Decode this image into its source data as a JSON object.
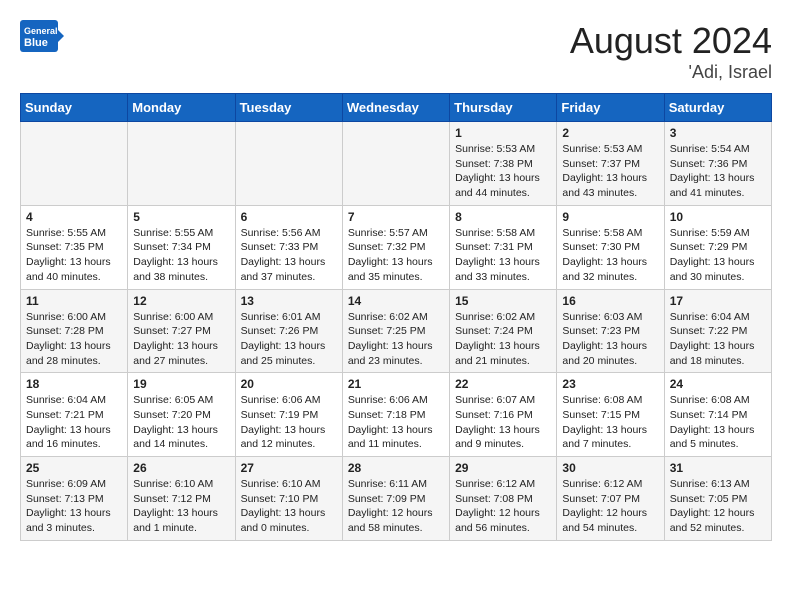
{
  "header": {
    "logo_general": "General",
    "logo_blue": "Blue",
    "month_year": "August 2024",
    "location": "'Adi, Israel"
  },
  "weekdays": [
    "Sunday",
    "Monday",
    "Tuesday",
    "Wednesday",
    "Thursday",
    "Friday",
    "Saturday"
  ],
  "weeks": [
    [
      {
        "day": "",
        "info": ""
      },
      {
        "day": "",
        "info": ""
      },
      {
        "day": "",
        "info": ""
      },
      {
        "day": "",
        "info": ""
      },
      {
        "day": "1",
        "info": "Sunrise: 5:53 AM\nSunset: 7:38 PM\nDaylight: 13 hours\nand 44 minutes."
      },
      {
        "day": "2",
        "info": "Sunrise: 5:53 AM\nSunset: 7:37 PM\nDaylight: 13 hours\nand 43 minutes."
      },
      {
        "day": "3",
        "info": "Sunrise: 5:54 AM\nSunset: 7:36 PM\nDaylight: 13 hours\nand 41 minutes."
      }
    ],
    [
      {
        "day": "4",
        "info": "Sunrise: 5:55 AM\nSunset: 7:35 PM\nDaylight: 13 hours\nand 40 minutes."
      },
      {
        "day": "5",
        "info": "Sunrise: 5:55 AM\nSunset: 7:34 PM\nDaylight: 13 hours\nand 38 minutes."
      },
      {
        "day": "6",
        "info": "Sunrise: 5:56 AM\nSunset: 7:33 PM\nDaylight: 13 hours\nand 37 minutes."
      },
      {
        "day": "7",
        "info": "Sunrise: 5:57 AM\nSunset: 7:32 PM\nDaylight: 13 hours\nand 35 minutes."
      },
      {
        "day": "8",
        "info": "Sunrise: 5:58 AM\nSunset: 7:31 PM\nDaylight: 13 hours\nand 33 minutes."
      },
      {
        "day": "9",
        "info": "Sunrise: 5:58 AM\nSunset: 7:30 PM\nDaylight: 13 hours\nand 32 minutes."
      },
      {
        "day": "10",
        "info": "Sunrise: 5:59 AM\nSunset: 7:29 PM\nDaylight: 13 hours\nand 30 minutes."
      }
    ],
    [
      {
        "day": "11",
        "info": "Sunrise: 6:00 AM\nSunset: 7:28 PM\nDaylight: 13 hours\nand 28 minutes."
      },
      {
        "day": "12",
        "info": "Sunrise: 6:00 AM\nSunset: 7:27 PM\nDaylight: 13 hours\nand 27 minutes."
      },
      {
        "day": "13",
        "info": "Sunrise: 6:01 AM\nSunset: 7:26 PM\nDaylight: 13 hours\nand 25 minutes."
      },
      {
        "day": "14",
        "info": "Sunrise: 6:02 AM\nSunset: 7:25 PM\nDaylight: 13 hours\nand 23 minutes."
      },
      {
        "day": "15",
        "info": "Sunrise: 6:02 AM\nSunset: 7:24 PM\nDaylight: 13 hours\nand 21 minutes."
      },
      {
        "day": "16",
        "info": "Sunrise: 6:03 AM\nSunset: 7:23 PM\nDaylight: 13 hours\nand 20 minutes."
      },
      {
        "day": "17",
        "info": "Sunrise: 6:04 AM\nSunset: 7:22 PM\nDaylight: 13 hours\nand 18 minutes."
      }
    ],
    [
      {
        "day": "18",
        "info": "Sunrise: 6:04 AM\nSunset: 7:21 PM\nDaylight: 13 hours\nand 16 minutes."
      },
      {
        "day": "19",
        "info": "Sunrise: 6:05 AM\nSunset: 7:20 PM\nDaylight: 13 hours\nand 14 minutes."
      },
      {
        "day": "20",
        "info": "Sunrise: 6:06 AM\nSunset: 7:19 PM\nDaylight: 13 hours\nand 12 minutes."
      },
      {
        "day": "21",
        "info": "Sunrise: 6:06 AM\nSunset: 7:18 PM\nDaylight: 13 hours\nand 11 minutes."
      },
      {
        "day": "22",
        "info": "Sunrise: 6:07 AM\nSunset: 7:16 PM\nDaylight: 13 hours\nand 9 minutes."
      },
      {
        "day": "23",
        "info": "Sunrise: 6:08 AM\nSunset: 7:15 PM\nDaylight: 13 hours\nand 7 minutes."
      },
      {
        "day": "24",
        "info": "Sunrise: 6:08 AM\nSunset: 7:14 PM\nDaylight: 13 hours\nand 5 minutes."
      }
    ],
    [
      {
        "day": "25",
        "info": "Sunrise: 6:09 AM\nSunset: 7:13 PM\nDaylight: 13 hours\nand 3 minutes."
      },
      {
        "day": "26",
        "info": "Sunrise: 6:10 AM\nSunset: 7:12 PM\nDaylight: 13 hours\nand 1 minute."
      },
      {
        "day": "27",
        "info": "Sunrise: 6:10 AM\nSunset: 7:10 PM\nDaylight: 13 hours\nand 0 minutes."
      },
      {
        "day": "28",
        "info": "Sunrise: 6:11 AM\nSunset: 7:09 PM\nDaylight: 12 hours\nand 58 minutes."
      },
      {
        "day": "29",
        "info": "Sunrise: 6:12 AM\nSunset: 7:08 PM\nDaylight: 12 hours\nand 56 minutes."
      },
      {
        "day": "30",
        "info": "Sunrise: 6:12 AM\nSunset: 7:07 PM\nDaylight: 12 hours\nand 54 minutes."
      },
      {
        "day": "31",
        "info": "Sunrise: 6:13 AM\nSunset: 7:05 PM\nDaylight: 12 hours\nand 52 minutes."
      }
    ]
  ]
}
